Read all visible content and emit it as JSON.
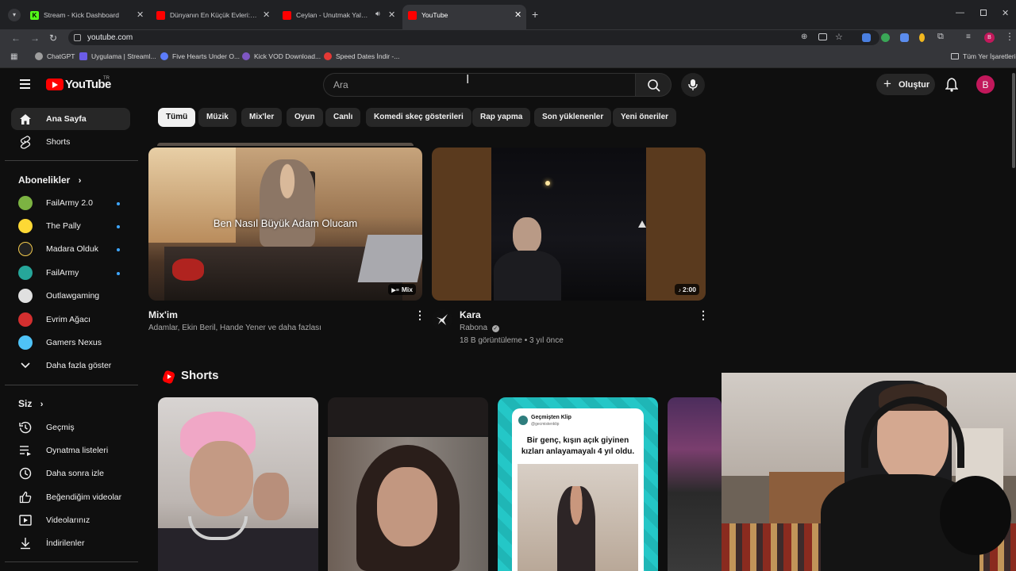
{
  "browser": {
    "tabs": [
      {
        "label": "Stream - Kick Dashboard",
        "favicon": "kick-icon"
      },
      {
        "label": "Dünyanın En Küçük Evleri: 1,5 m",
        "favicon": "youtube-icon"
      },
      {
        "label": "Ceylan - Unutmak Yalan - Y",
        "favicon": "youtube-icon"
      },
      {
        "label": "YouTube",
        "favicon": "youtube-icon"
      }
    ],
    "url": "youtube.com",
    "bookmarks": [
      "ChatGPT",
      "Uygulama | Streaml...",
      "Five Hearts Under O...",
      "Kick VOD Download...",
      "Speed Dates İndir -..."
    ],
    "all_bookmarks": "Tüm Yer İşaretleri",
    "profile_initial": "B"
  },
  "header": {
    "logo_text": "YouTube",
    "logo_region": "TR",
    "search_placeholder": "Ara",
    "create_label": "Oluştur",
    "avatar_initial": "B"
  },
  "sidebar": {
    "main": [
      {
        "label": "Ana Sayfa",
        "icon": "home-icon"
      },
      {
        "label": "Shorts",
        "icon": "shorts-icon"
      }
    ],
    "subscriptions_title": "Abonelikler",
    "subscriptions": [
      {
        "label": "FailArmy 2.0",
        "color": "#7cb342"
      },
      {
        "label": "The Pally",
        "color": "#fdd835"
      },
      {
        "label": "Madara Olduk",
        "color": "#212121"
      },
      {
        "label": "FailArmy",
        "color": "#26a69a"
      },
      {
        "label": "Outlawgaming",
        "color": "#e0e0e0"
      },
      {
        "label": "Evrim Ağacı",
        "color": "#d32f2f"
      },
      {
        "label": "Gamers Nexus",
        "color": "#4fc3f7"
      }
    ],
    "show_more": "Daha fazla göster",
    "you_title": "Siz",
    "you_items": [
      {
        "label": "Geçmiş",
        "icon": "history-icon"
      },
      {
        "label": "Oynatma listeleri",
        "icon": "playlist-icon"
      },
      {
        "label": "Daha sonra izle",
        "icon": "clock-icon"
      },
      {
        "label": "Beğendiğim videolar",
        "icon": "thumbs-up-icon"
      },
      {
        "label": "Videolarınız",
        "icon": "video-icon"
      },
      {
        "label": "İndirilenler",
        "icon": "download-icon"
      }
    ]
  },
  "chips": [
    "Tümü",
    "Müzik",
    "Mix'ler",
    "Oyun",
    "Canlı",
    "Komedi skeç gösterileri",
    "Rap yapma",
    "Son yüklenenler",
    "Yeni öneriler"
  ],
  "videos": [
    {
      "title": "Mix'im",
      "subtitle": "Adamlar, Ekin Beril, Hande Yener ve daha fazlası",
      "overlay": "Ben Nasıl Büyük Adam Olucam",
      "badge": "Mix"
    },
    {
      "title": "Kara",
      "channel": "Rabona",
      "meta": "18 B görüntüleme • 3 yıl önce",
      "badge": "2:00"
    }
  ],
  "shorts": {
    "title": "Shorts",
    "items": [
      {
        "type": "person"
      },
      {
        "type": "person"
      },
      {
        "account_name": "Geçmişten Klip",
        "account_handle": "@gecmistenklip",
        "caption": "Bir genç, kışın açık giyinen kızları anlayamayalı 4 yıl oldu."
      },
      {
        "type": "partial"
      }
    ]
  }
}
